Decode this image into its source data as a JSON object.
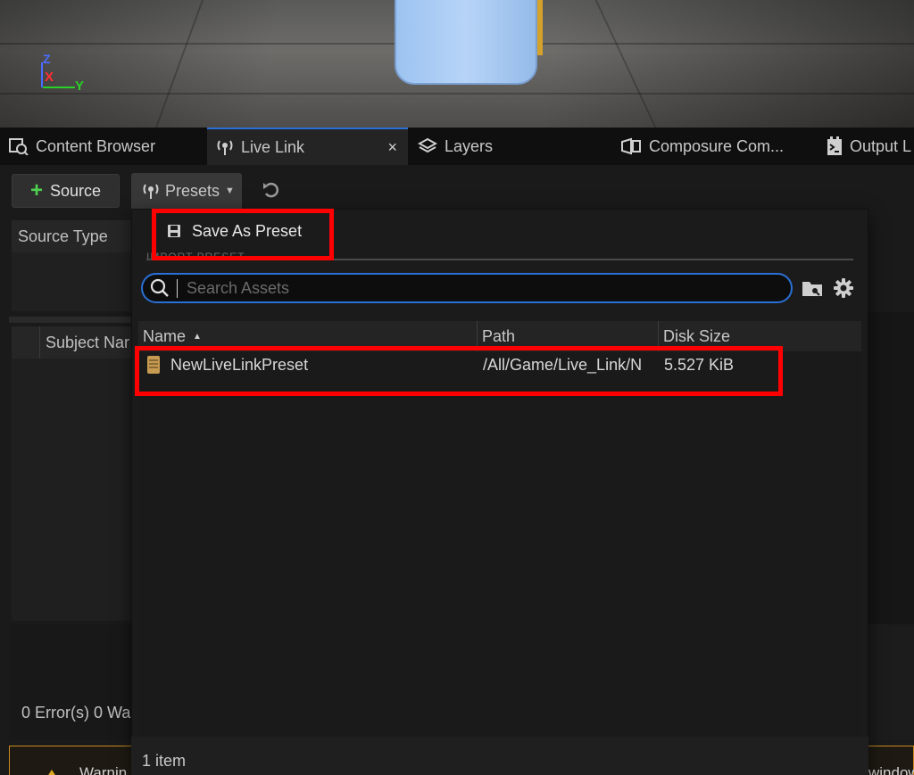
{
  "viewport": {
    "axis_labels": {
      "z": "Z",
      "x": "X",
      "y": "Y"
    }
  },
  "tabs": [
    {
      "label": "Content Browser",
      "icon": "content-browser-icon"
    },
    {
      "label": "Live Link",
      "icon": "live-link-icon",
      "active": true
    },
    {
      "label": "Layers",
      "icon": "layers-icon"
    },
    {
      "label": "Composure Com...",
      "icon": "composure-icon"
    },
    {
      "label": "Output L",
      "icon": "output-log-icon"
    }
  ],
  "tab_close": "×",
  "toolbar": {
    "source_label": "Source",
    "presets_label": "Presets"
  },
  "left_panel": {
    "source_type_header": "Source Type",
    "subject_name_header": "Subject Nar",
    "status_text": "0 Error(s)  0 Wa"
  },
  "warning_bar": {
    "left_text": "Warnin",
    "right_text": "window"
  },
  "presets_menu": {
    "save_label": "Save As Preset",
    "section_header": "IMPORT PRESET",
    "search_placeholder": "Search Assets",
    "columns": [
      "Name",
      "Path",
      "Disk Size"
    ],
    "rows": [
      {
        "name": "NewLiveLinkPreset",
        "path": "/All/Game/Live_Link/N",
        "disk_size": "5.527 KiB"
      }
    ],
    "item_count": "1 item"
  },
  "colors": {
    "accent": "#2a6fd6",
    "highlight": "#ff0000",
    "add_green": "#4fd14f",
    "warning": "#c98b1d"
  }
}
